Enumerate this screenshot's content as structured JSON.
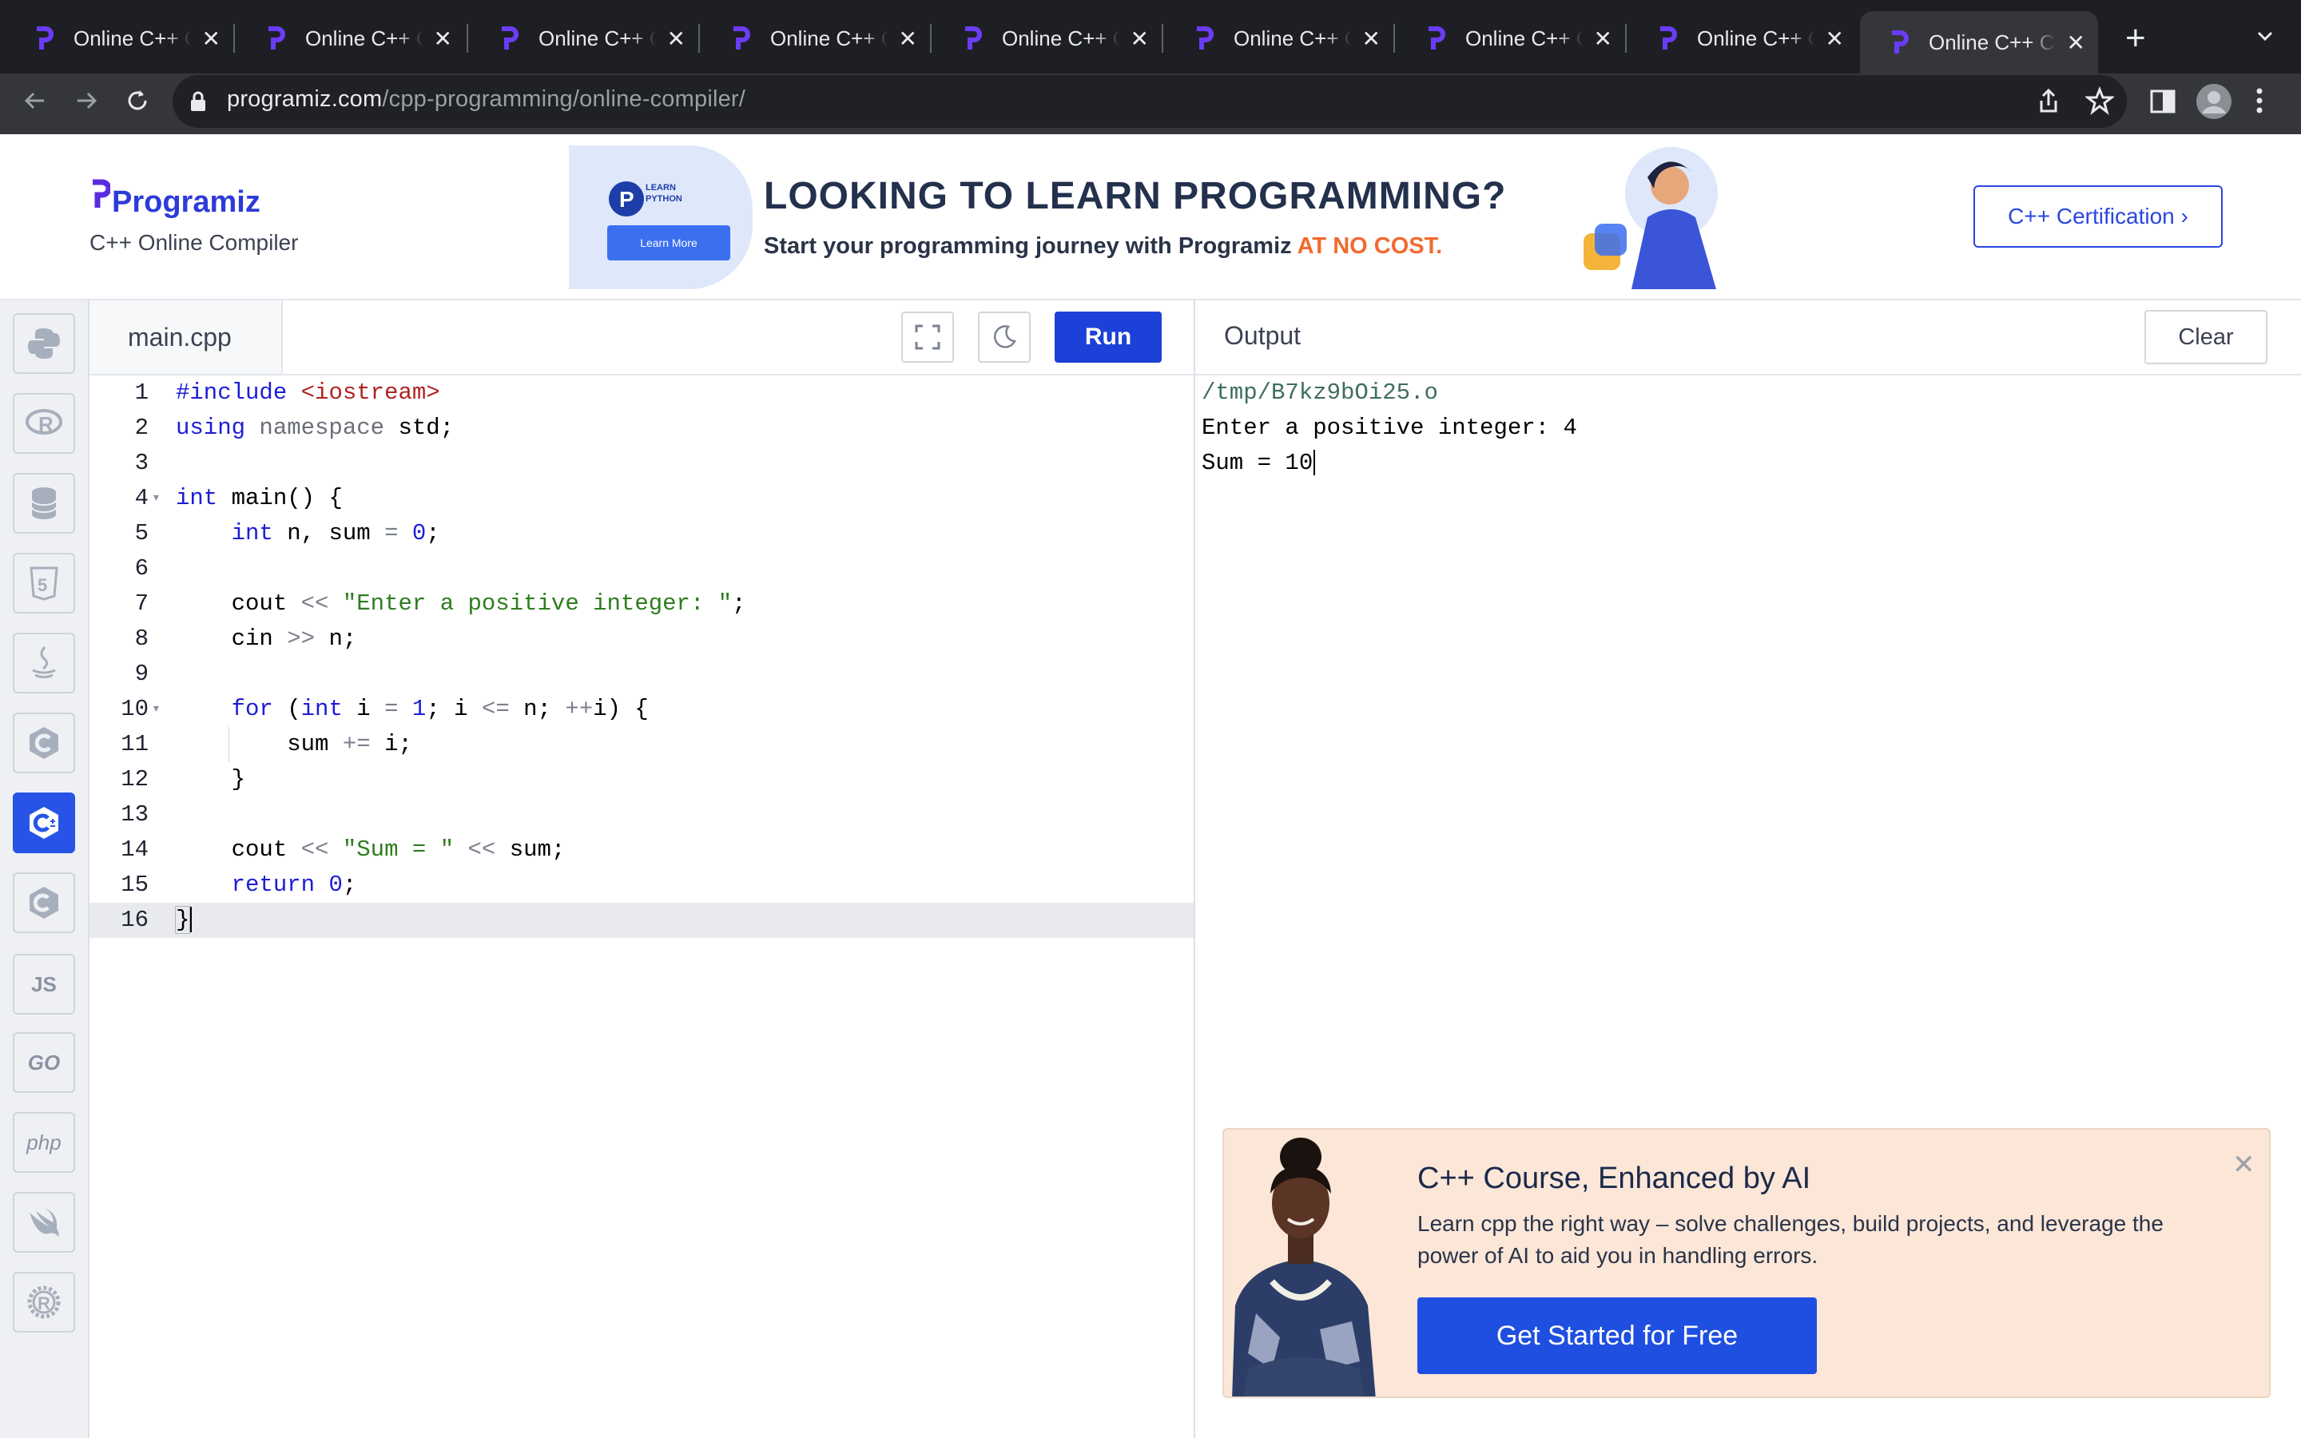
{
  "browser": {
    "tab_title": "Online C++ Compiler - Programiz",
    "tab_close": "✕",
    "new_tab": "+",
    "url_domain": "programiz.com",
    "url_path": "/cpp-programming/online-compiler/"
  },
  "site": {
    "logo": "Programiz",
    "subtitle": "C++ Online Compiler",
    "certification_button": "C++ Certification ›"
  },
  "ad": {
    "badge": "LEARN PYTHON",
    "learn_more": "Learn More",
    "headline": "LOOKING TO LEARN PROGRAMMING?",
    "tagline": "Start your programming journey with Programiz",
    "tagline_highlight": "AT NO COST."
  },
  "languages": {
    "js": "JS",
    "go": "GO",
    "php": "php"
  },
  "editor": {
    "file_name": "main.cpp",
    "run_label": "Run"
  },
  "code": {
    "l1": "#include",
    "l1b": "<iostream>",
    "l2": "using",
    "l2b": "namespace",
    "l2c": "std;",
    "l4": "int",
    "l4b": "main() {",
    "l5": "int",
    "l5b": "n, sum",
    "l5c": "=",
    "l5d": "0",
    "l5e": ";",
    "l7": "cout",
    "l7b": "<<",
    "l7c": "\"Enter a positive integer: \"",
    "l7d": ";",
    "l8": "cin",
    "l8b": ">>",
    "l8c": "n;",
    "l10": "for",
    "l10b": "(",
    "l10c": "int",
    "l10d": "i",
    "l10e": "=",
    "l10f": "1",
    "l10g": "; i",
    "l10h": "<=",
    "l10i": "n;",
    "l10j": "++",
    "l10k": "i) {",
    "l11": "sum",
    "l11b": "+=",
    "l11c": "i;",
    "l12": "}",
    "l14": "cout",
    "l14b": "<<",
    "l14c": "\"Sum = \"",
    "l14d": "<<",
    "l14e": "sum;",
    "l15": "return",
    "l15b": "0",
    "l15c": ";",
    "l16": "}"
  },
  "output": {
    "title": "Output",
    "clear_label": "Clear",
    "lines": [
      "/tmp/B7kz9bOi25.o",
      "Enter a positive integer: 4",
      "Sum = 10"
    ]
  },
  "promo": {
    "title": "C++ Course, Enhanced by AI",
    "description": "Learn cpp the right way – solve challenges, build projects, and leverage the power of AI to aid you in handling errors.",
    "cta": "Get Started for Free",
    "close": "✕"
  },
  "colors": {
    "brand_blue": "#1d41d8",
    "browser_dark": "#1e1f24",
    "promo_bg": "#fbe6d8"
  }
}
